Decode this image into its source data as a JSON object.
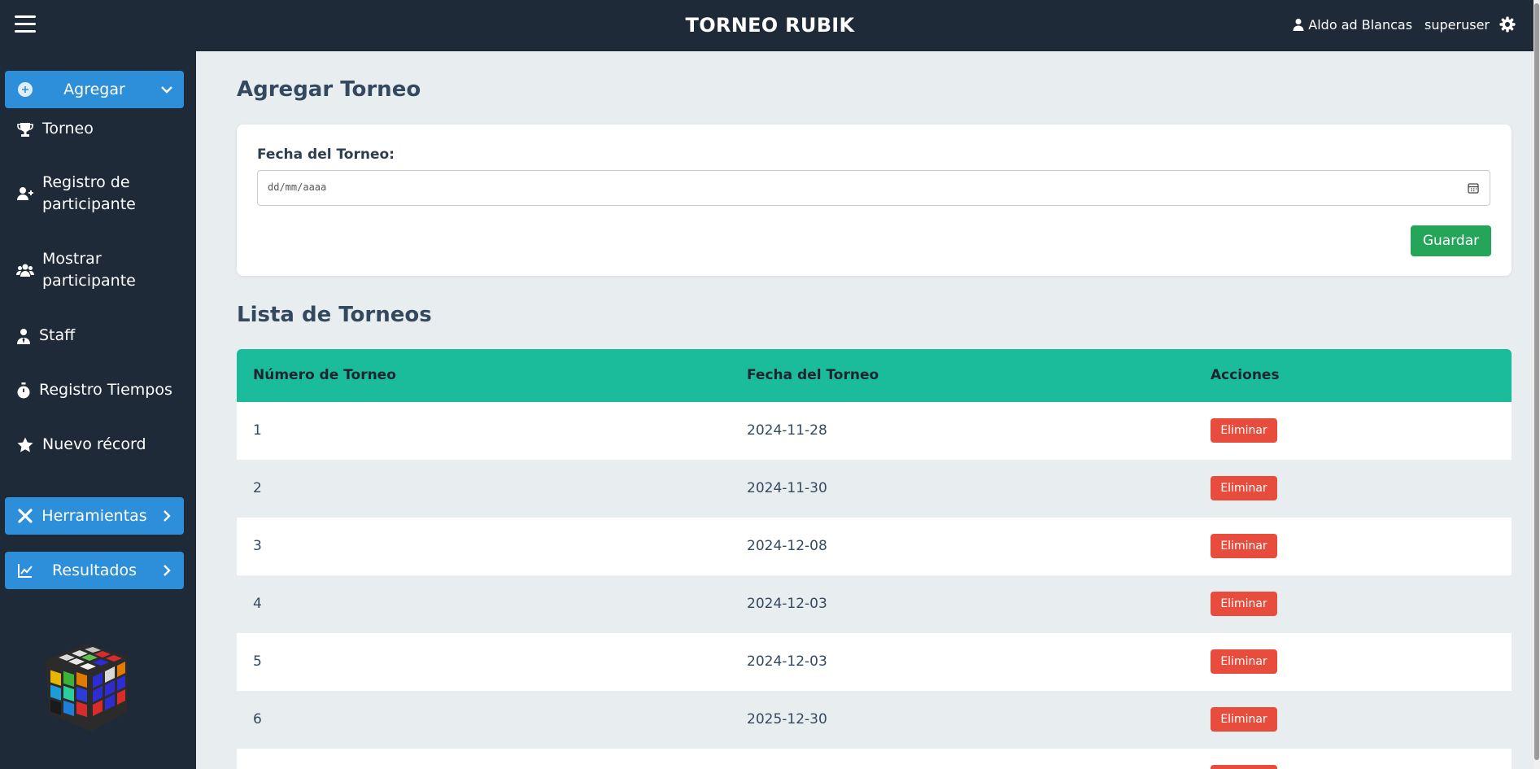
{
  "header": {
    "title": "TORNEO RUBIK",
    "user_name": "Aldo ad Blancas",
    "role": "superuser"
  },
  "sidebar": {
    "add_button": "Agregar",
    "items": [
      {
        "label": "Torneo",
        "icon": "trophy-icon"
      },
      {
        "label": "Registro de participante",
        "icon": "user-plus-icon"
      },
      {
        "label": "Mostrar participante",
        "icon": "users-icon"
      },
      {
        "label": "Staff",
        "icon": "user-tie-icon"
      },
      {
        "label": "Registro Tiempos",
        "icon": "stopwatch-icon"
      },
      {
        "label": "Nuevo récord",
        "icon": "star-icon"
      }
    ],
    "tools_button": "Herramientas",
    "results_button": "Resultados"
  },
  "form": {
    "title": "Agregar Torneo",
    "date_label": "Fecha del Torneo:",
    "date_placeholder": "dd/mm/aaaa",
    "save_label": "Guardar"
  },
  "list": {
    "title": "Lista de Torneos",
    "columns": [
      "Número de Torneo",
      "Fecha del Torneo",
      "Acciones"
    ],
    "rows": [
      {
        "num": "1",
        "date": "2024-11-28",
        "action": "Eliminar"
      },
      {
        "num": "2",
        "date": "2024-11-30",
        "action": "Eliminar"
      },
      {
        "num": "3",
        "date": "2024-12-08",
        "action": "Eliminar"
      },
      {
        "num": "4",
        "date": "2024-12-03",
        "action": "Eliminar"
      },
      {
        "num": "5",
        "date": "2024-12-03",
        "action": "Eliminar"
      },
      {
        "num": "6",
        "date": "2025-12-30",
        "action": "Eliminar"
      }
    ]
  },
  "colors": {
    "topbar": "#1f2a38",
    "accent_blue": "#2d8fd9",
    "table_header": "#1abc9c",
    "save_green": "#25a55a",
    "delete_red": "#e74c3c"
  }
}
